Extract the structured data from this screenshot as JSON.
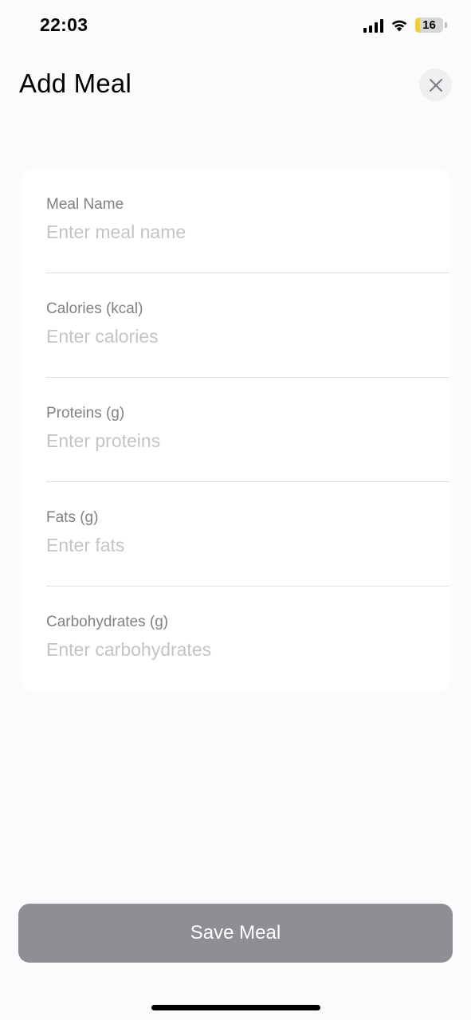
{
  "status_bar": {
    "time": "22:03",
    "battery_level": "16",
    "battery_fraction": 0.16,
    "icons": [
      "cellular-signal-icon",
      "wifi-icon",
      "battery-icon"
    ]
  },
  "header": {
    "title": "Add Meal",
    "close_icon": "close-icon"
  },
  "form": {
    "fields": [
      {
        "label": "Meal Name",
        "placeholder": "Enter meal name",
        "value": ""
      },
      {
        "label": "Calories (kcal)",
        "placeholder": "Enter calories",
        "value": ""
      },
      {
        "label": "Proteins (g)",
        "placeholder": "Enter proteins",
        "value": ""
      },
      {
        "label": "Fats (g)",
        "placeholder": "Enter fats",
        "value": ""
      },
      {
        "label": "Carbohydrates (g)",
        "placeholder": "Enter carbohydrates",
        "value": ""
      }
    ]
  },
  "footer": {
    "save_label": "Save Meal"
  },
  "colors": {
    "background": "#fbfbfd",
    "card": "#ffffff",
    "label": "#808085",
    "placeholder": "#c4c4c7",
    "button_disabled": "#8e8e93",
    "battery_low": "#f4cd2a"
  }
}
